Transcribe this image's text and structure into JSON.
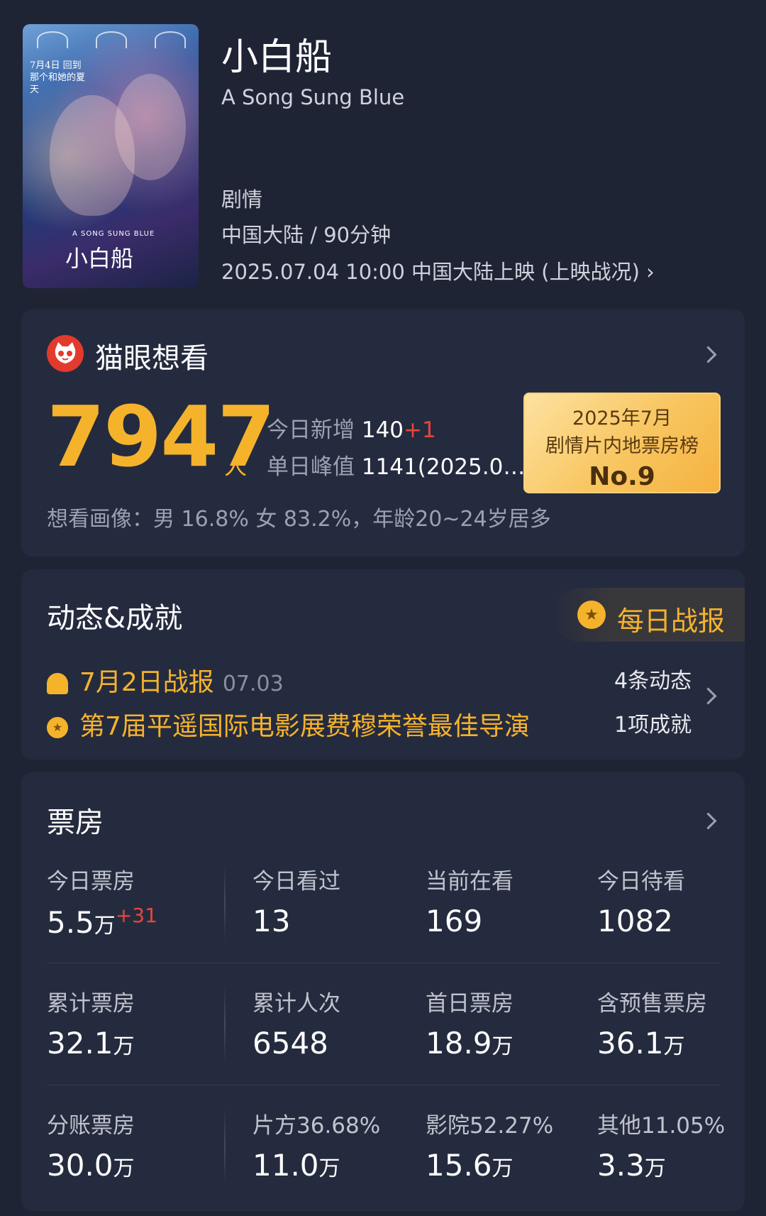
{
  "movie": {
    "title": "小白船",
    "subtitle": "A Song Sung Blue",
    "genre": "剧情",
    "region_duration": "中国大陆 / 90分钟",
    "release": "2025.07.04 10:00 中国大陆上映 (上映战况)",
    "poster": {
      "date_text": "7月4日 回到那个和她的夏天",
      "poster_title": "小白船",
      "poster_sub": "A SONG SUNG BLUE"
    }
  },
  "want": {
    "title": "猫眼想看",
    "number": "7947",
    "unit": "人",
    "today_label": "今日新增",
    "today_value": "140",
    "today_inc": "+1",
    "peak_label": "单日峰值",
    "peak_value": "1141(2025.0…",
    "portrait": "想看画像：男 16.8%  女 83.2%，年龄20~24岁居多",
    "rank_line1": "2025年7月",
    "rank_line2": "剧情片内地票房榜",
    "rank_line3": "No.9"
  },
  "news": {
    "title": "动态&成就",
    "daily_button": "每日战报",
    "item1_text": "7月2日战报",
    "item1_date": "07.03",
    "item2_text": "第7届平遥国际电影展费穆荣誉最佳导演",
    "count1": "4条动态",
    "count2": "1项成就"
  },
  "boxoffice": {
    "title": "票房",
    "rows": [
      [
        {
          "label": "今日票房",
          "value": "5.5",
          "unit": "万",
          "inc": "+31"
        },
        {
          "label": "今日看过",
          "value": "13",
          "unit": "",
          "inc": ""
        },
        {
          "label": "当前在看",
          "value": "169",
          "unit": "",
          "inc": ""
        },
        {
          "label": "今日待看",
          "value": "1082",
          "unit": "",
          "inc": ""
        }
      ],
      [
        {
          "label": "累计票房",
          "value": "32.1",
          "unit": "万",
          "inc": ""
        },
        {
          "label": "累计人次",
          "value": "6548",
          "unit": "",
          "inc": ""
        },
        {
          "label": "首日票房",
          "value": "18.9",
          "unit": "万",
          "inc": ""
        },
        {
          "label": "含预售票房",
          "value": "36.1",
          "unit": "万",
          "inc": ""
        }
      ],
      [
        {
          "label": "分账票房",
          "value": "30.0",
          "unit": "万",
          "inc": ""
        },
        {
          "label": "片方36.68%",
          "value": "11.0",
          "unit": "万",
          "inc": ""
        },
        {
          "label": "影院52.27%",
          "value": "15.6",
          "unit": "万",
          "inc": ""
        },
        {
          "label": "其他11.05%",
          "value": "3.3",
          "unit": "万",
          "inc": ""
        }
      ]
    ]
  },
  "colors": {
    "background": "#1f2435",
    "card": "#252b3e",
    "accent": "#f5b32c",
    "increase": "#e8463a"
  }
}
